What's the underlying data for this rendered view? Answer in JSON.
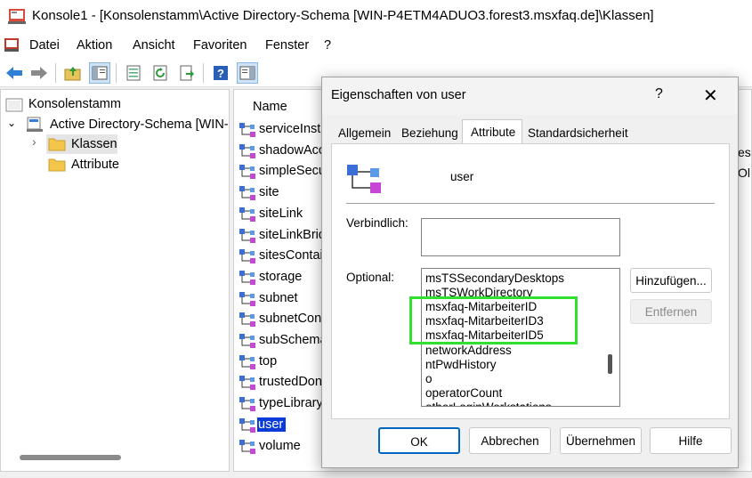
{
  "window": {
    "title": "Konsole1 - [Konsolenstamm\\Active Directory-Schema [WIN-P4ETM4ADUO3.forest3.msxfaq.de]\\Klassen]"
  },
  "menu": {
    "items": [
      "Datei",
      "Aktion",
      "Ansicht",
      "Favoriten",
      "Fenster",
      "?"
    ]
  },
  "tree": {
    "root": "Konsolenstamm",
    "schema": "Active Directory-Schema [WIN-",
    "classes": "Klassen",
    "attributes": "Attribute"
  },
  "list": {
    "header": "Name",
    "rows": [
      "serviceInsta",
      "shadowAcco",
      "simpleSecu",
      "site",
      "siteLink",
      "siteLinkBrid",
      "sitesContai",
      "storage",
      "subnet",
      "subnetCon",
      "subSchema",
      "top",
      "trustedDon",
      "typeLibrary",
      "user",
      "volume"
    ],
    "selected": "user",
    "peek_text": [
      "es",
      "Ol"
    ]
  },
  "dialog": {
    "title": "Eigenschaften von user",
    "help": "?",
    "close": "✕",
    "tabs": [
      "Allgemein",
      "Beziehung",
      "Attribute",
      "Standardsicherheit"
    ],
    "active_tab": "Attribute",
    "object_name": "user",
    "mandatory_label": "Verbindlich:",
    "optional_label": "Optional:",
    "optional_items": [
      "msTSSecondaryDesktops",
      "msTSWorkDirectory",
      "msxfaq-MitarbeiterID",
      "msxfaq-MitarbeiterID3",
      "msxfaq-MitarbeiterID5",
      "networkAddress",
      "ntPwdHistory",
      "o",
      "operatorCount",
      "otherLoginWorkstations"
    ],
    "add_button": "Hinzufügen...",
    "remove_button": "Entfernen",
    "buttons": {
      "ok": "OK",
      "cancel": "Abbrechen",
      "apply": "Übernehmen",
      "help": "Hilfe"
    }
  },
  "colors": {
    "selection": "#0a3bd9",
    "highlight_frame": "#2fe02f",
    "default_button_border": "#0067c0"
  }
}
